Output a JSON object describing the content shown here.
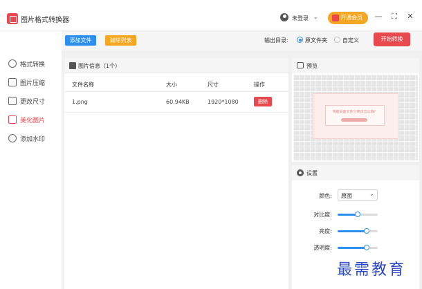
{
  "app": {
    "title": "图片格式转换器"
  },
  "header": {
    "login_label": "未登录",
    "login_chevron": "⌄",
    "vip_label": "开通会员",
    "minimize": "—",
    "maximize": "⛶",
    "close": "✕"
  },
  "sidebar": {
    "items": [
      {
        "label": "格式转换",
        "active": false
      },
      {
        "label": "图片压缩",
        "active": false
      },
      {
        "label": "更改尺寸",
        "active": false
      },
      {
        "label": "美化图片",
        "active": true
      },
      {
        "label": "添加水印",
        "active": false
      }
    ]
  },
  "toolbar": {
    "add_file": "添加文件",
    "clear_list": "清除列表",
    "output_label": "输出目录:",
    "option_original": "原文件夹",
    "option_custom": "自定义",
    "selected_option": "原文件夹",
    "start": "开始转换"
  },
  "file_panel": {
    "title": "图片信息（1个）",
    "columns": [
      "文件名称",
      "大小",
      "尺寸",
      "操作"
    ],
    "rows": [
      {
        "name": "1.png",
        "size": "60.94KB",
        "dimensions": "1920*1080",
        "action": "删除"
      }
    ]
  },
  "preview": {
    "title": "预览",
    "image_text": "电脑桌面文件分类该怎么做？"
  },
  "settings": {
    "title": "设置",
    "color_label": "颜色:",
    "color_value": "原图",
    "chevron": "⌄",
    "contrast_label": "对比度:",
    "contrast_value": 0.5,
    "brightness_label": "亮度:",
    "brightness_value": 0.72,
    "transparency_label": "透明度:",
    "transparency_value": 0.72
  },
  "watermark": "最需教育",
  "colors": {
    "accent_blue": "#2e8ef0",
    "accent_orange": "#f5a623",
    "accent_red": "#e8484e",
    "watermark_blue": "#2b48c2"
  }
}
